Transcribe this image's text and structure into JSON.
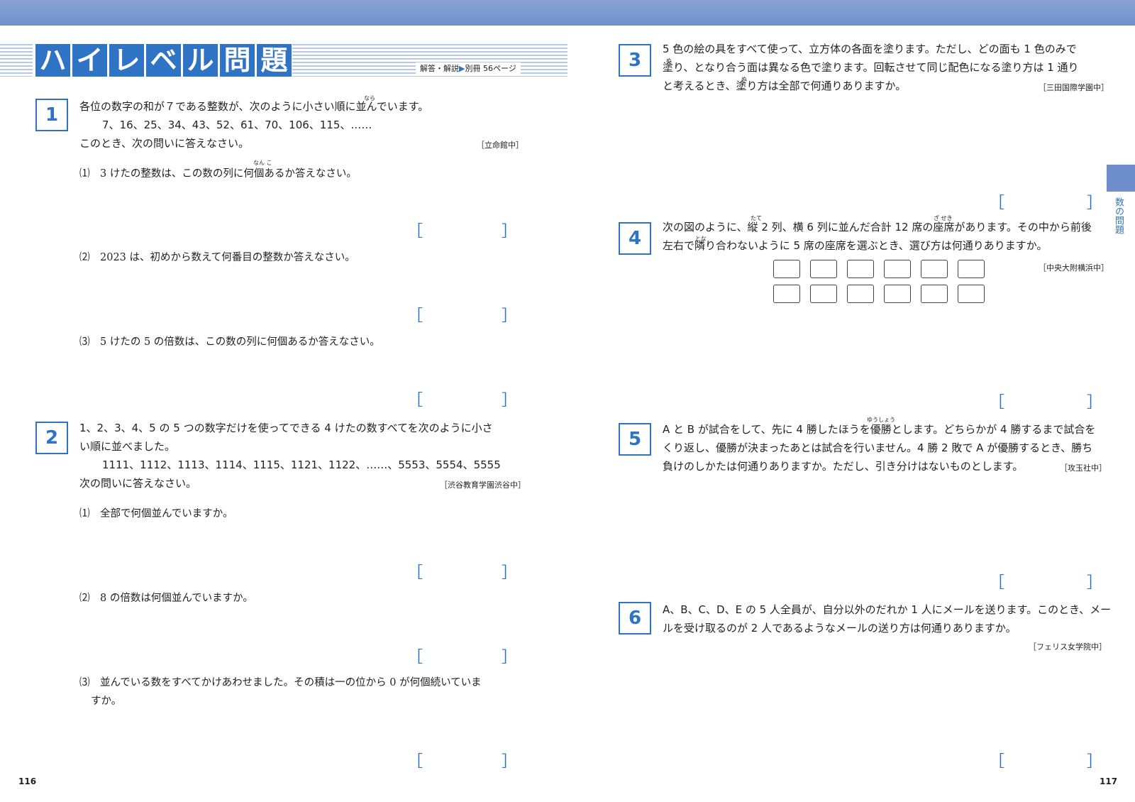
{
  "header": {
    "title_chars": [
      "ハ",
      "イ",
      "レ",
      "ベ",
      "ル",
      "問",
      "題"
    ],
    "ref_label": "解答・解説",
    "ref_target": "別冊 56ページ"
  },
  "left": {
    "p1": {
      "num": "1",
      "line1": "各位の数字の和が７である整数が、次のように小さい順に並んでいます。",
      "line2": "7、16、25、34、43、52、61、70、106、115、……",
      "line3": "このとき、次の問いに答えなさい。",
      "source": "［立命館中］",
      "q1": "⑴　3 けたの整数は、この数の列に何個あるか答えなさい。",
      "q2": "⑵　2023 は、初めから数えて何番目の整数か答えなさい。",
      "q3": "⑶　5 けたの 5 の倍数は、この数の列に何個あるか答えなさい。"
    },
    "p2": {
      "num": "2",
      "line1": "1、2、3、4、5 の 5 つの数字だけを使ってできる 4 けたの数すべてを次のように小さ",
      "line2": "い順に並べました。",
      "line3": "1111、1112、1113、1114、1115、1121、1122、……、5553、5554、5555",
      "line4": "次の問いに答えなさい。",
      "source": "［渋谷教育学園渋谷中］",
      "q1": "⑴　全部で何個並んでいますか。",
      "q2": "⑵　8 の倍数は何個並んでいますか。",
      "q3a": "⑶　並んでいる数をすべてかけあわせました。その積は一の位から 0 が何個続いていま",
      "q3b": "すか。"
    }
  },
  "right": {
    "p3": {
      "num": "3",
      "line1": "5 色の絵の具をすべて使って、立方体の各面を塗ります。ただし、どの面も 1 色のみで",
      "line2": "塗り、となり合う面は異なる色で塗ります。回転させて同じ配色になる塗り方は 1 通り",
      "line3": "と考えるとき、塗り方は全部で何通りありますか。",
      "source": "［三田国際学園中］"
    },
    "p4": {
      "num": "4",
      "line1": "次の図のように、縦 2 列、横 6 列に並んだ合計 12 席の座席があります。その中から前後",
      "line2": "左右で隣り合わないように 5 席の座席を選ぶとき、選び方は何通りありますか。",
      "source": "［中央大附横浜中］",
      "ruby1": "たて",
      "ruby2": "ざ せき",
      "ruby3": "とな"
    },
    "p5": {
      "num": "5",
      "line1": "A と B が試合をして、先に 4 勝したほうを優勝とします。どちらかが 4 勝するまで試合を",
      "line2": "くり返し、優勝が決まったあとは試合を行いません。4 勝 2 敗で A が優勝するとき、勝ち",
      "line3": "負けのしかたは何通りありますか。ただし、引き分けはないものとします。",
      "source": "［攻玉社中］",
      "ruby": "ゆうしょう"
    },
    "p6": {
      "num": "6",
      "line1": "A、B、C、D、E の 5 人全員が、自分以外のだれか 1 人にメールを送ります。このとき、メー",
      "line2": "ルを受け取るのが 2 人であるようなメールの送り方は何通りありますか。",
      "source": "［フェリス女学院中］"
    }
  },
  "misc": {
    "bracket_open": "［",
    "bracket_close": "］",
    "side_tab": "数の問題",
    "ruby_nara": "なら",
    "ruby_nanko": "なん こ",
    "ruby_nu": "ぬ",
    "page_left": "116",
    "page_right": "117"
  },
  "colors": {
    "accent": "#2f73c4",
    "header_band": "#7b96cf"
  }
}
